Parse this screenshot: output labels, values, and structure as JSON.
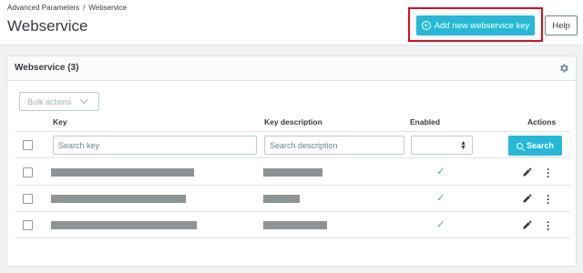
{
  "breadcrumb": {
    "items": [
      "Advanced Parameters",
      "Webservice"
    ],
    "separator": "/"
  },
  "page": {
    "title": "Webservice"
  },
  "toolbar": {
    "add_label": "Add new webservice key",
    "help_label": "Help"
  },
  "card": {
    "title": "Webservice",
    "count": "(3)"
  },
  "bulk": {
    "label": "Bulk actions"
  },
  "table": {
    "headers": {
      "key": "Key",
      "description": "Key description",
      "enabled": "Enabled",
      "actions": "Actions"
    },
    "filters": {
      "key_placeholder": "Search key",
      "description_placeholder": "Search description",
      "search_label": "Search"
    },
    "rows": [
      {
        "enabled": true
      },
      {
        "enabled": true
      },
      {
        "enabled": true
      }
    ]
  },
  "colors": {
    "accent": "#25b9d7",
    "highlight": "#e00b1b",
    "enabled_check": "#70b580"
  },
  "icons": [
    "plus-circle-icon",
    "gear-icon",
    "chevron-down-icon",
    "sort-icon",
    "search-icon",
    "check-icon",
    "pencil-icon",
    "kebab-icon"
  ]
}
